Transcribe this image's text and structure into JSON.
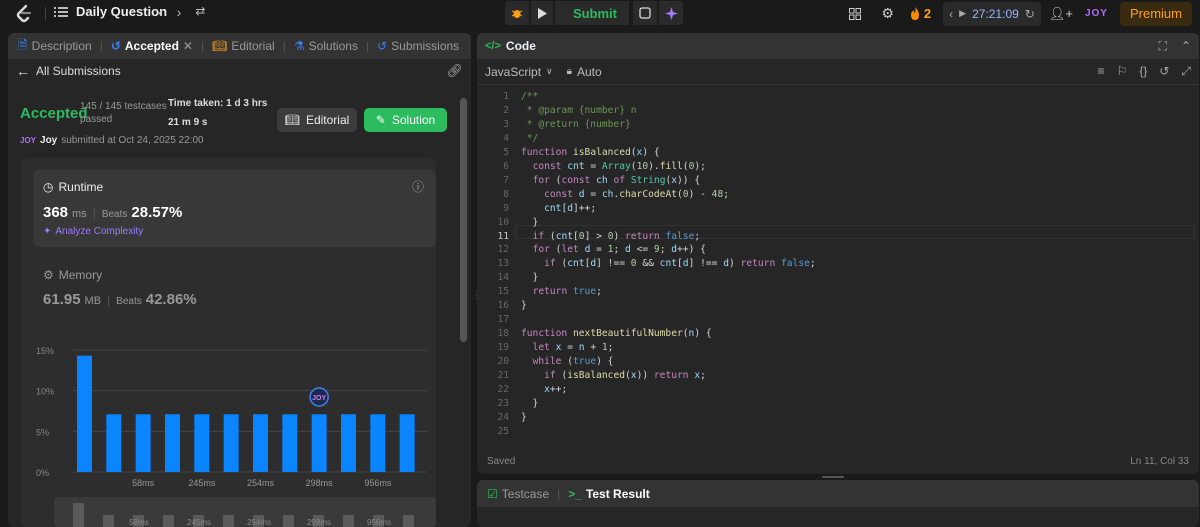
{
  "topbar": {
    "title": "Daily Question",
    "submit_label": "Submit",
    "streak": "2",
    "timer": "27:21:09",
    "user_badge": "JOY",
    "premium_label": "Premium"
  },
  "left_panel": {
    "tabs": [
      {
        "label": "Description"
      },
      {
        "label": "Accepted"
      },
      {
        "label": "Editorial"
      },
      {
        "label": "Solutions"
      },
      {
        "label": "Submissions"
      }
    ],
    "all_submissions": "All Submissions",
    "status": "Accepted",
    "testcases": "145 / 145 testcases",
    "passed": "passed",
    "time_taken_line1": "Time taken: 1 d 3 hrs",
    "time_taken_line2": "21 m 9 s",
    "editorial_btn": "Editorial",
    "solution_btn": "Solution",
    "user_badge": "JOY",
    "username": "Joy",
    "submitted_at": "submitted at Oct 24, 2025 22:00",
    "runtime": {
      "label": "Runtime",
      "value": "368",
      "unit": "ms",
      "beats_label": "Beats",
      "beats_value": "28.57%",
      "analyze": "Analyze Complexity"
    },
    "memory": {
      "label": "Memory",
      "value": "61.95",
      "unit": "MB",
      "beats_label": "Beats",
      "beats_value": "42.86%"
    }
  },
  "chart_data": {
    "type": "bar",
    "y_ticks": [
      "15%",
      "10%",
      "5%",
      "0%"
    ],
    "ylim": [
      0,
      15
    ],
    "values": [
      14.3,
      7.1,
      7.1,
      7.1,
      7.1,
      7.1,
      7.1,
      7.1,
      7.1,
      7.1,
      7.1,
      7.1
    ],
    "x_labels": [
      "58ms",
      "245ms",
      "254ms",
      "298ms",
      "956ms"
    ],
    "marker_label": "JOY",
    "bar_color": "#0a84ff"
  },
  "mini_chart_labels": [
    "58ms",
    "245ms",
    "254ms",
    "298ms",
    "956ms"
  ],
  "code_panel": {
    "title": "Code",
    "language": "JavaScript",
    "mode": "Auto",
    "status": "Saved",
    "cursor": "Ln 11, Col 33",
    "lines": [
      "/**",
      " * @param {number} n",
      " * @return {number}",
      " */",
      "function isBalanced(x) {",
      "  const cnt = Array(10).fill(0);",
      "  for (const ch of String(x)) {",
      "    const d = ch.charCodeAt(0) - 48;",
      "    cnt[d]++;",
      "  }",
      "  if (cnt[0] > 0) return false;",
      "  for (let d = 1; d <= 9; d++) {",
      "    if (cnt[d] !== 0 && cnt[d] !== d) return false;",
      "  }",
      "  return true;",
      "}",
      "",
      "function nextBeautifulNumber(n) {",
      "  let x = n + 1;",
      "  while (true) {",
      "    if (isBalanced(x)) return x;",
      "    x++;",
      "  }",
      "}",
      ""
    ]
  },
  "bottom_panel": {
    "testcase_tab": "Testcase",
    "result_tab": "Test Result"
  }
}
